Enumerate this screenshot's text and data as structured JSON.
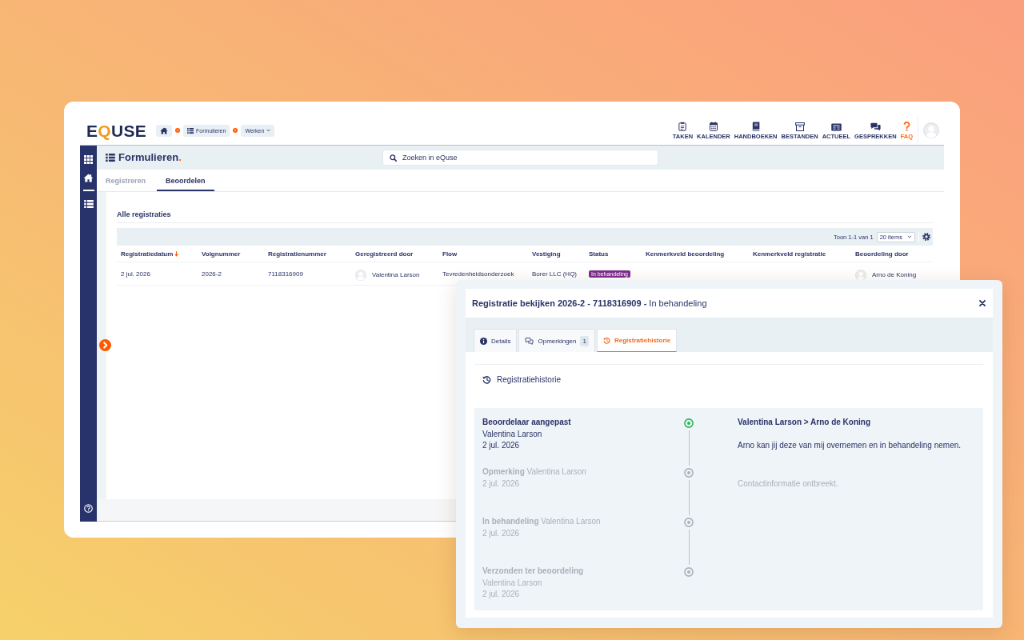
{
  "logo": [
    {
      "text": "E",
      "accent": false
    },
    {
      "text": "Q",
      "accent": true
    },
    {
      "text": "USE",
      "accent": false
    }
  ],
  "breadcrumbs": [
    {
      "label": "Formulieren",
      "dropdown": false
    },
    {
      "label": "Werken",
      "dropdown": true
    }
  ],
  "top_nav": [
    {
      "label": "TAKEN",
      "highlight": false
    },
    {
      "label": "KALENDER",
      "highlight": false
    },
    {
      "label": "HANDBOEKEN",
      "highlight": false
    },
    {
      "label": "BESTANDEN",
      "highlight": false
    },
    {
      "label": "ACTUEEL",
      "highlight": false
    },
    {
      "label": "GESPREKKEN",
      "highlight": false
    },
    {
      "label": "FAQ",
      "highlight": true
    }
  ],
  "page": {
    "title": "Formulieren",
    "title_suffix": ".",
    "search": {
      "placeholder": "Zoeken in eQuse"
    }
  },
  "tabs": [
    {
      "label": "Registreren",
      "selected": false
    },
    {
      "label": "Beoordelen",
      "selected": true
    }
  ],
  "section_title": "Alle registraties",
  "table": {
    "pager": {
      "summary": "Toon 1-1 van 1",
      "page_size": "20 items"
    },
    "columns": [
      {
        "label": "Registratiedatum",
        "sorted": true
      },
      {
        "label": "Volgnummer",
        "sorted": false
      },
      {
        "label": "Registratienummer",
        "sorted": false
      },
      {
        "label": "Geregistreerd door",
        "sorted": false
      },
      {
        "label": "Flow",
        "sorted": false
      },
      {
        "label": "Vestiging",
        "sorted": false
      },
      {
        "label": "Status",
        "sorted": false
      },
      {
        "label": "Kenmerkveld beoordeling",
        "sorted": false
      },
      {
        "label": "Kenmerkveld registratie",
        "sorted": false
      },
      {
        "label": "Beoordeling door",
        "sorted": false
      }
    ],
    "rows": [
      {
        "cells": [
          {
            "kind": "text",
            "text": "2 jul. 2026"
          },
          {
            "kind": "text",
            "text": "2026-2"
          },
          {
            "kind": "text",
            "text": "7118316909"
          },
          {
            "kind": "user",
            "text": "Valentina Larson"
          },
          {
            "kind": "text",
            "text": "Tevredenheidsonderzoek"
          },
          {
            "kind": "text",
            "text": "Borer LLC (HQ)"
          },
          {
            "kind": "badge",
            "text": "In behandeling",
            "color": "#7b2c8c"
          },
          {
            "kind": "blank"
          },
          {
            "kind": "blank"
          },
          {
            "kind": "user",
            "text": "Arno de Koning"
          }
        ]
      }
    ]
  },
  "dialog": {
    "title": "**Registratie bekijken 2026-2 - 7118316909 -** In behandeling",
    "tabs": [
      {
        "label": "Details",
        "selected": false
      },
      {
        "label": "Opmerkingen",
        "count": "1",
        "selected": false
      },
      {
        "label": "Registratiehistorie",
        "selected": true
      }
    ],
    "section_title": "Registratiehistorie",
    "timeline": [
      {
        "event": "Beoordelaar aangepast",
        "user": "Valentina Larson",
        "date": "2 jul. 2026",
        "active": true,
        "heading": "Valentina Larson > Arno de Koning",
        "note": "Arno kan jij deze van mij overnemen en in behandeling nemen."
      },
      {
        "event": "Opmerking",
        "user": "Valentina Larson",
        "date": "2 jul. 2026",
        "active": false,
        "note": "Contactinformatie ontbreekt."
      },
      {
        "event": "In behandeling",
        "user": "Valentina Larson",
        "date": "2 jul. 2026",
        "active": false
      },
      {
        "event": "Verzonden ter beoordeling",
        "user": "Valentina Larson",
        "date": "2 jul. 2026",
        "active": false
      }
    ]
  }
}
